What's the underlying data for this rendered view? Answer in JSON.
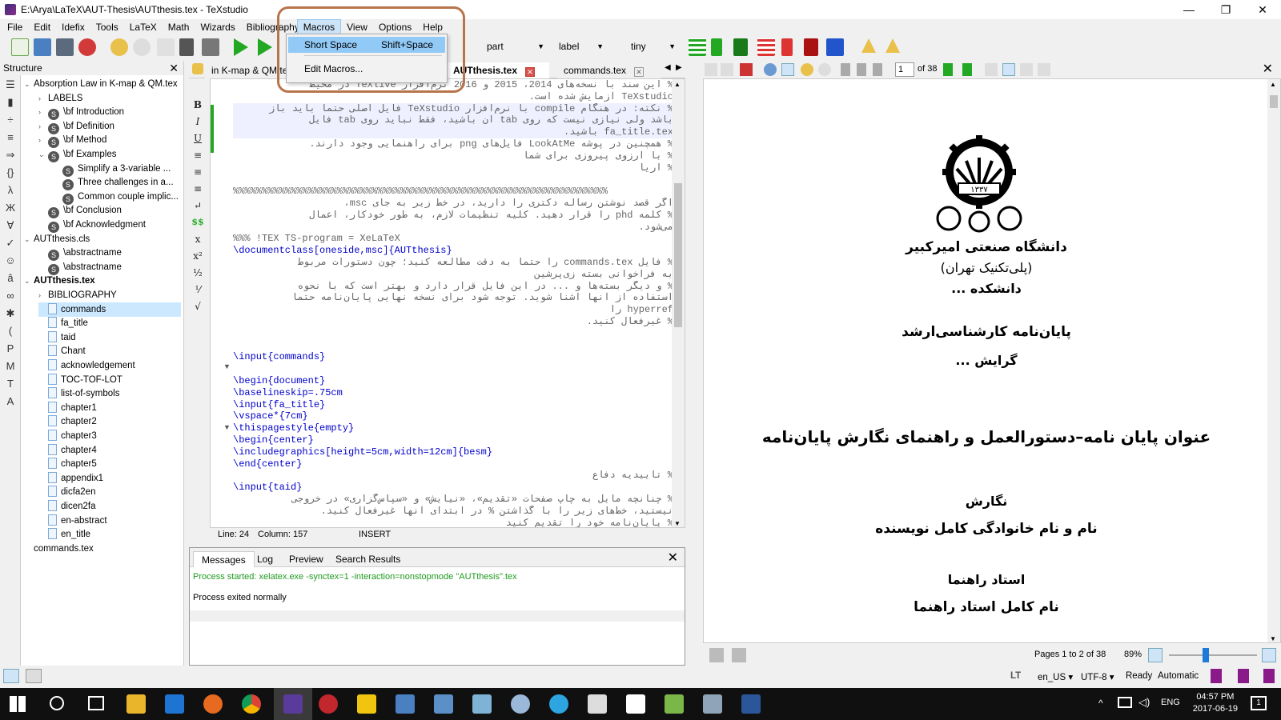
{
  "window": {
    "title": "E:\\Arya\\LaTeX\\AUT-Thesis\\AUTthesis.tex - TeXstudio",
    "minimize": "—",
    "maximize": "❐",
    "close": "✕"
  },
  "menubar": [
    "File",
    "Edit",
    "Idefix",
    "Tools",
    "LaTeX",
    "Math",
    "Wizards",
    "Bibliography",
    "Macros",
    "View",
    "Options",
    "Help"
  ],
  "toolbar": {
    "combo_part": "part",
    "combo_label": "label",
    "combo_size": "tiny"
  },
  "macros_menu": {
    "short_space": "Short Space",
    "short_space_shortcut": "Shift+Space",
    "edit_macros": "Edit Macros..."
  },
  "structure": {
    "header": "Structure",
    "close": "✕",
    "items": [
      {
        "label": "Absorption Law in K-map & QM.tex",
        "exp": "⌄",
        "icon": "none",
        "bold": false
      },
      {
        "label": "LABELS",
        "exp": "›",
        "icon": "none",
        "bold": false
      },
      {
        "label": "\\bf Introduction",
        "exp": "›",
        "icon": "sect",
        "bold": false
      },
      {
        "label": "\\bf Definition",
        "exp": "›",
        "icon": "sect",
        "bold": false
      },
      {
        "label": "\\bf Method",
        "exp": "›",
        "icon": "sect",
        "bold": false
      },
      {
        "label": "\\bf Examples",
        "exp": "⌄",
        "icon": "sect",
        "bold": false
      },
      {
        "label": "Simplify a 3-variable ...",
        "exp": "",
        "icon": "sect",
        "bold": false
      },
      {
        "label": "Three challenges in a...",
        "exp": "",
        "icon": "sect",
        "bold": false
      },
      {
        "label": "Common couple implic...",
        "exp": "",
        "icon": "sect",
        "bold": false
      },
      {
        "label": "\\bf Conclusion",
        "exp": "",
        "icon": "sect",
        "bold": false
      },
      {
        "label": "\\bf Acknowledgment",
        "exp": "",
        "icon": "sect",
        "bold": false
      },
      {
        "label": "AUTthesis.cls",
        "exp": "⌄",
        "icon": "none",
        "bold": false
      },
      {
        "label": "\\abstractname",
        "exp": "",
        "icon": "sect",
        "bold": false
      },
      {
        "label": "\\abstractname",
        "exp": "",
        "icon": "sect",
        "bold": false
      },
      {
        "label": "AUTthesis.tex",
        "exp": "⌄",
        "icon": "none",
        "bold": true
      },
      {
        "label": "BIBLIOGRAPHY",
        "exp": "›",
        "icon": "none",
        "bold": false
      },
      {
        "label": "commands",
        "exp": "",
        "icon": "file",
        "bold": false,
        "selected": true
      },
      {
        "label": "fa_title",
        "exp": "",
        "icon": "file",
        "bold": false
      },
      {
        "label": "taid",
        "exp": "",
        "icon": "file",
        "bold": false
      },
      {
        "label": "Chant",
        "exp": "",
        "icon": "file",
        "bold": false
      },
      {
        "label": "acknowledgement",
        "exp": "",
        "icon": "file",
        "bold": false
      },
      {
        "label": "TOC-TOF-LOT",
        "exp": "",
        "icon": "file",
        "bold": false
      },
      {
        "label": "list-of-symbols",
        "exp": "",
        "icon": "file",
        "bold": false
      },
      {
        "label": "chapter1",
        "exp": "",
        "icon": "file",
        "bold": false
      },
      {
        "label": "chapter2",
        "exp": "",
        "icon": "file",
        "bold": false
      },
      {
        "label": "chapter3",
        "exp": "",
        "icon": "file",
        "bold": false
      },
      {
        "label": "chapter4",
        "exp": "",
        "icon": "file",
        "bold": false
      },
      {
        "label": "chapter5",
        "exp": "",
        "icon": "file",
        "bold": false
      },
      {
        "label": "appendix1",
        "exp": "",
        "icon": "file",
        "bold": false
      },
      {
        "label": "dicfa2en",
        "exp": "",
        "icon": "file",
        "bold": false
      },
      {
        "label": "dicen2fa",
        "exp": "",
        "icon": "file",
        "bold": false
      },
      {
        "label": "en-abstract",
        "exp": "",
        "icon": "file",
        "bold": false
      },
      {
        "label": "en_title",
        "exp": "",
        "icon": "file",
        "bold": false
      },
      {
        "label": "commands.tex",
        "exp": "",
        "icon": "none",
        "bold": false
      }
    ]
  },
  "tabs": {
    "tab1": "in K-map & QM.tex",
    "tab2": "AUTthesis.tex",
    "tab3": "commands.tex"
  },
  "editor": {
    "lines": [
      {
        "t": "% این سند با نسخه‌های 2014، 2015 و 2016 نرم‌افزار TeXlive در محیط",
        "rtl": true
      },
      {
        "t": "TeXstudio آزمایش شده است.",
        "rtl": true
      },
      {
        "t": "% نکته: در هنگام compile با نرم‌افزار TeXstudio فایل اصلی حتما باید باز",
        "rtl": true,
        "hl": true
      },
      {
        "t": "باشد ولی نیازی نیست که روی tab آن باشید، فقط نباید روی tab فایل",
        "rtl": true,
        "hl": true
      },
      {
        "t": "fa_title.tex باشید.",
        "rtl": true,
        "hl": true
      },
      {
        "t": "% همچنین در پوشه LookAtMe فایل‌های png برای راهنمایی وجود دارند.",
        "rtl": true
      },
      {
        "t": "% با آرزوی پیروزی برای شما",
        "rtl": true
      },
      {
        "t": "% آریا",
        "rtl": true
      },
      {
        "t": "",
        "rtl": false
      },
      {
        "t": "%%%%%%%%%%%%%%%%%%%%%%%%%%%%%%%%%%%%%%%%%%%%%%%%%%%%%%%%%%%%%%%%%",
        "rtl": false,
        "cls": "cm"
      },
      {
        "t": "اگر قصد نوشتن رساله دکتری را دارید، در خط زیر به جای msc،",
        "rtl": true
      },
      {
        "t": "% کلمه phd را قرار دهید. کلیه تنظیمات لازم، به طور خودکار، اعمال",
        "rtl": true
      },
      {
        "t": "می‌شود.",
        "rtl": true
      },
      {
        "t": "%%% !TEX TS-program = XeLaTeX",
        "rtl": false,
        "cls": "cm"
      },
      {
        "t": "\\documentclass[oneside,msc]{AUTthesis}",
        "rtl": false,
        "cls": "kwl"
      },
      {
        "t": "% فایل commands.tex را حتماً به دقت مطالعه کنید؛ چون دستورات مربوط",
        "rtl": true
      },
      {
        "t": "به فراخوانی بسته زی‌پرشین",
        "rtl": true
      },
      {
        "t": "% و دیگر بسته‌ها و ... در این فایل قرار دارد و بهتر است که با نحوه",
        "rtl": true
      },
      {
        "t": "استفاده از آنها آشنا شوید. توجه شود برای نسخه نهایی پایان‌نامه حتماً",
        "rtl": true
      },
      {
        "t": "hyperref را",
        "rtl": true
      },
      {
        "t": "% غیرفعال کنید.",
        "rtl": true
      },
      {
        "t": "",
        "rtl": false
      },
      {
        "t": "",
        "rtl": false
      },
      {
        "t": "\\input{commands}",
        "rtl": false,
        "cls": "kwl"
      },
      {
        "t": "",
        "rtl": false
      },
      {
        "t": "\\begin{document}",
        "rtl": false,
        "cls": "kwb"
      },
      {
        "t": "\\baselineskip=.75cm",
        "rtl": false,
        "cls": "kwl"
      },
      {
        "t": "\\input{fa_title}",
        "rtl": false,
        "cls": "kwl"
      },
      {
        "t": "\\vspace*{7cm}",
        "rtl": false,
        "cls": "kwl"
      },
      {
        "t": "\\thispagestyle{empty}",
        "rtl": false,
        "cls": "kwl"
      },
      {
        "t": "\\begin{center}",
        "rtl": false,
        "cls": "kwb"
      },
      {
        "t": "\\includegraphics[height=5cm,width=12cm]{besm}",
        "rtl": false,
        "cls": "kwl"
      },
      {
        "t": "\\end{center}",
        "rtl": false,
        "cls": "kwb"
      },
      {
        "t": "% تاییدیه دفاع",
        "rtl": true
      },
      {
        "t": "\\input{taid}",
        "rtl": false,
        "cls": "kwl"
      },
      {
        "t": "% چنانچه مایل به چاپ صفحات «تقدیم»، «نیایش» و «سپاس‌گزاری» در خروجی",
        "rtl": true
      },
      {
        "t": "نیستید، خط‌های زیر را با گذاشتن % در ابتدای آنها غیرفعال کنید.",
        "rtl": true
      },
      {
        "t": "% پایان‌نامه خود را تقدیم کنید",
        "rtl": true
      }
    ],
    "status_line": "Line: 24",
    "status_col": "Column: 157",
    "status_mode": "INSERT"
  },
  "messages": {
    "tabs": [
      "Messages",
      "Log",
      "Preview",
      "Search Results"
    ],
    "line1": "Process started: xelatex.exe -synctex=1 -interaction=nonstopmode \"AUTthesis\".tex",
    "line2": "Process exited normally",
    "close": "✕"
  },
  "pdf": {
    "page_current": "1",
    "page_of": "of 38",
    "university": "دانشگاه صنعتی امیرکبیر",
    "polytech": "(پلی‌تکنیک تهران)",
    "faculty": "دانشکده ...",
    "degree": "پایان‌نامه کارشناسی‌ارشد",
    "field": "گرایش ...",
    "thesis_title": "عنوان پایان نامه–دستورالعمل و راهنمای نگارش پایان‌نامه",
    "author_label": "نگارش",
    "author_name": "نام و نام خانوادگی کامل نویسنده",
    "advisor_label": "استاد راهنما",
    "advisor_name": "نام کامل استاد راهنما",
    "logo_numerals": "۱۳۳۷",
    "pages_info": "Pages 1 to 2 of 38",
    "zoom": "89%",
    "close": "✕"
  },
  "statusbar": {
    "lang": "en_US",
    "encoding": "UTF-8",
    "ready": "Ready",
    "mode": "Automatic"
  },
  "taskbar": {
    "time": "04:57 PM",
    "date": "2017-06-19",
    "lang": "ENG",
    "notifications": "1"
  },
  "colors": {
    "accent_highlight": "#b8744a",
    "menu_hover": "#91c9f7",
    "keyword": "#0000cc",
    "green_run": "#22a822"
  }
}
